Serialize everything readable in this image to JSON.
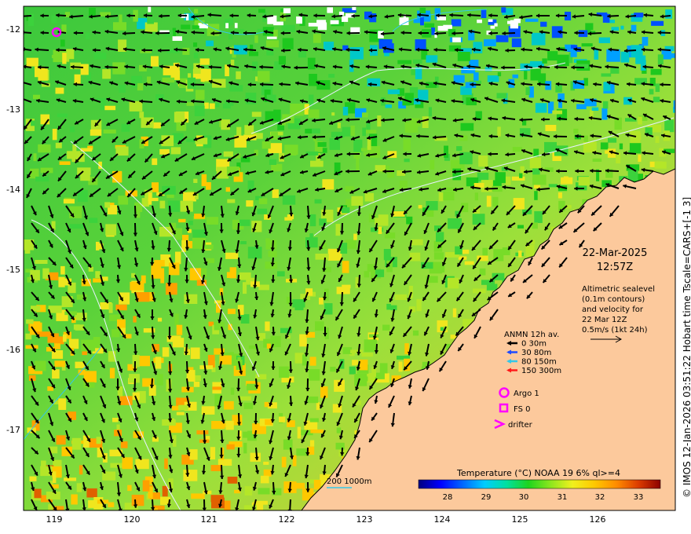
{
  "map": {
    "datetime": {
      "date": "22-Mar-2025",
      "time": "12:57Z"
    },
    "description": [
      "Altimetric sealevel",
      "(0.1m contours)",
      "and velocity for",
      "22 Mar 12Z",
      "0.5m/s (1kt 24h)"
    ],
    "lat_ticks": [
      "-12",
      "-13",
      "-14",
      "-15",
      "-16",
      "-17"
    ],
    "lon_ticks": [
      "119",
      "120",
      "121",
      "122",
      "123",
      "124",
      "125",
      "126"
    ],
    "legend": {
      "title": "ANMN 12h av.",
      "items": [
        {
          "label": "0 30m",
          "color": "#000000"
        },
        {
          "label": "30 80m",
          "color": "#1f4bff"
        },
        {
          "label": "80 150m",
          "color": "#35c7e8"
        },
        {
          "label": "150 300m",
          "color": "#ff1a1a"
        }
      ],
      "argo": "Argo 1",
      "fs": "FS 0",
      "drifter": "drifter",
      "marker_color": "#ff00ff"
    },
    "bathy_label": "200  1000m",
    "colorbar": {
      "title": "Temperature (°C) NOAA 19 6% ql>=4",
      "ticks": [
        "28",
        "29",
        "30",
        "31",
        "32",
        "33"
      ],
      "colors": [
        "#00007f",
        "#0000ff",
        "#0066ff",
        "#00ccff",
        "#00e0a0",
        "#1ed41e",
        "#8ce61e",
        "#f0f01e",
        "#ffc800",
        "#ff8c00",
        "#dc3c00",
        "#8c0000"
      ]
    },
    "credit": "© IMOS 12-Jan-2026 03:51:22 Hobart time Tscale=CARS+[-1 3]",
    "land_color": "#fcc99c"
  }
}
